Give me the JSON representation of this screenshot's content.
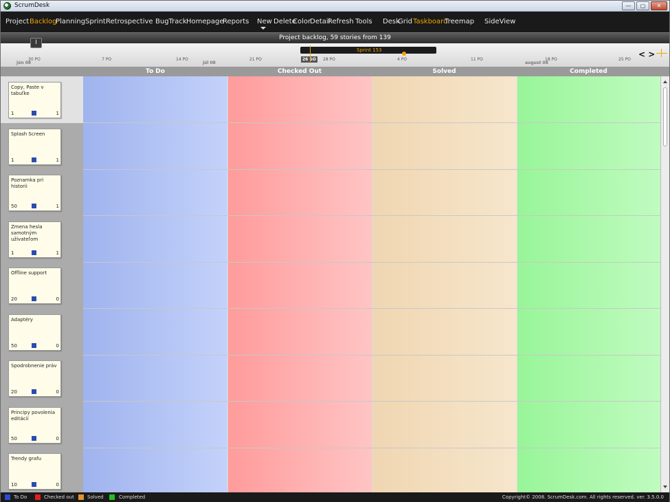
{
  "window": {
    "title": "ScrumDesk",
    "minimize": "—",
    "maximize": "▢",
    "close": "✕"
  },
  "menu": {
    "items": [
      {
        "label": "Project",
        "active": false
      },
      {
        "label": "Backlog",
        "active": true
      },
      {
        "label": "Planning",
        "active": false
      },
      {
        "label": "Sprint",
        "active": false
      },
      {
        "label": "Retrospective",
        "active": false
      },
      {
        "label": "BugTrack",
        "active": false
      },
      {
        "label": "Homepage",
        "active": false
      },
      {
        "label": "Reports",
        "active": false
      },
      {
        "label": "New",
        "active": false
      },
      {
        "label": "Delete",
        "active": false
      },
      {
        "label": "Color",
        "active": false
      },
      {
        "label": "Detail",
        "active": false
      },
      {
        "label": "Refresh",
        "active": false
      },
      {
        "label": "Tools",
        "active": false
      },
      {
        "label": "Desk",
        "active": false
      },
      {
        "label": "Grid",
        "active": false
      },
      {
        "label": "Taskboard",
        "active": true
      },
      {
        "label": "Treemap",
        "active": false
      },
      {
        "label": "SideView",
        "active": false
      }
    ]
  },
  "info": {
    "text": "Project backlog,  59 stories from 139",
    "button": "I"
  },
  "timeline": {
    "days": [
      "30 PO",
      "7 PO",
      "14 PO",
      "21 PO",
      "28 PO",
      "4 PO",
      "11 PO",
      "18 PO",
      "25 PO"
    ],
    "today": "26 SO",
    "months": [
      "jún 08",
      "júl 08",
      "august 08"
    ],
    "sprint_label": "Sprint 153",
    "nav": "< >"
  },
  "columns": [
    {
      "label": "To Do"
    },
    {
      "label": "Checked Out"
    },
    {
      "label": "Solved"
    },
    {
      "label": "Completed"
    }
  ],
  "stories": [
    {
      "name": "Copy, Paste v tabuľke",
      "points": "1",
      "priority": "1"
    },
    {
      "name": "Splash Screen",
      "points": "1",
      "priority": "1"
    },
    {
      "name": "Poznamka pri historii",
      "points": "50",
      "priority": "1"
    },
    {
      "name": "Zmena hesla samotným užívateľom",
      "points": "1",
      "priority": "1"
    },
    {
      "name": "Offline support",
      "points": "20",
      "priority": "0"
    },
    {
      "name": "Adaptéry",
      "points": "50",
      "priority": "0"
    },
    {
      "name": "Spodrobnenie práv",
      "points": "20",
      "priority": "0"
    },
    {
      "name": "Principy povolenia editácií",
      "points": "50",
      "priority": "0"
    },
    {
      "name": "Trendy grafu",
      "points": "10",
      "priority": "0"
    }
  ],
  "legend": [
    {
      "label": "To Do",
      "color": "#2a4cd0"
    },
    {
      "label": "Checked out",
      "color": "#e02020"
    },
    {
      "label": "Solved",
      "color": "#e0952a"
    },
    {
      "label": "Completed",
      "color": "#22c022"
    }
  ],
  "copyright": "Copyright© 2008. ScrumDesk.com. All rights reserved. ver. 3.5.0.0",
  "colors": {
    "accent": "#f0a400",
    "todo": "#a9bdf2",
    "checked_out": "#ffa5a5",
    "solved": "#f2dcbc",
    "completed": "#a3f7a3"
  }
}
